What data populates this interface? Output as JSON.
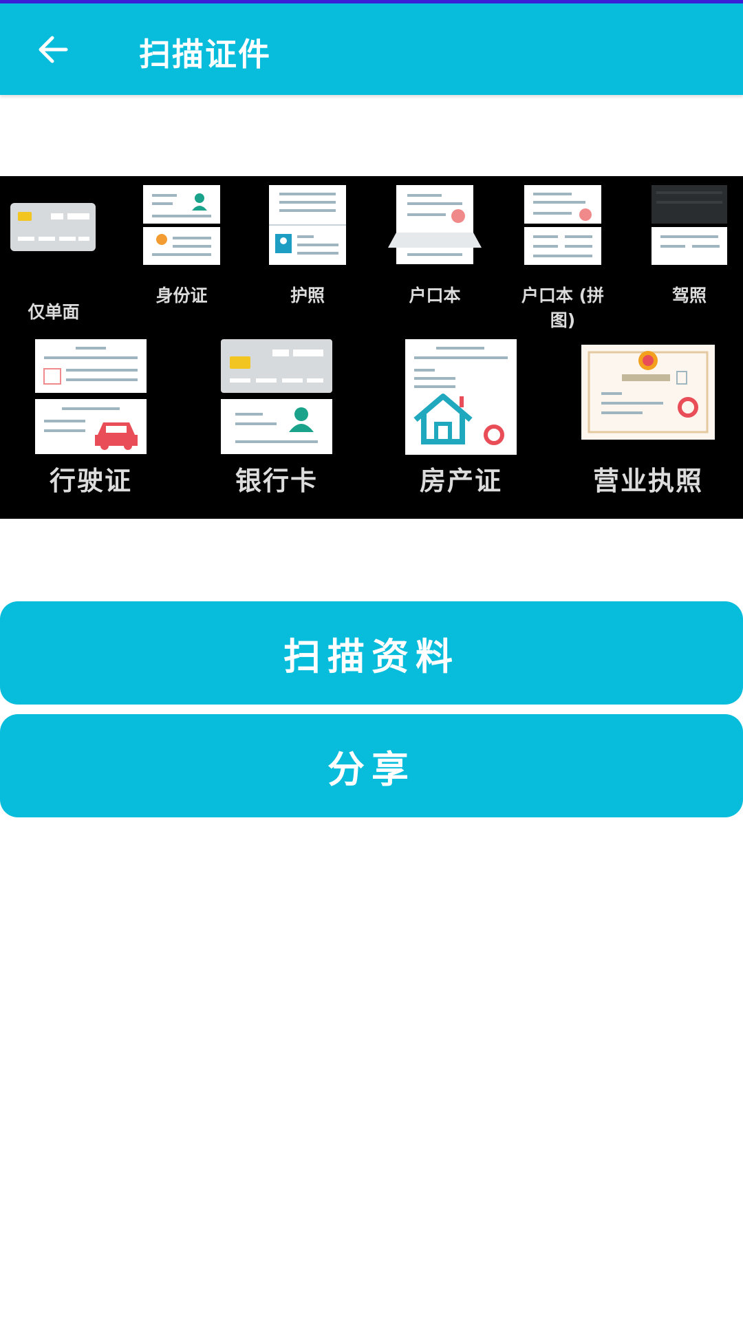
{
  "header": {
    "title": "扫描证件",
    "back_icon": "arrow-left-icon"
  },
  "banner": {
    "row1": [
      {
        "label": "仅单面"
      },
      {
        "label": "身份证"
      },
      {
        "label": "护照"
      },
      {
        "label": "户口本"
      },
      {
        "label": "户口本 (拼"
      },
      {
        "label": "驾照"
      }
    ],
    "row1_extra": "图)",
    "row2": [
      {
        "label": "行驶证"
      },
      {
        "label": "银行卡"
      },
      {
        "label": "房产证"
      },
      {
        "label": "营业执照"
      }
    ]
  },
  "actions": {
    "scan_label": "扫描资料",
    "share_label": "分享"
  },
  "colors": {
    "accent": "#08bcdc",
    "status_strip": "#3b1fd6"
  }
}
